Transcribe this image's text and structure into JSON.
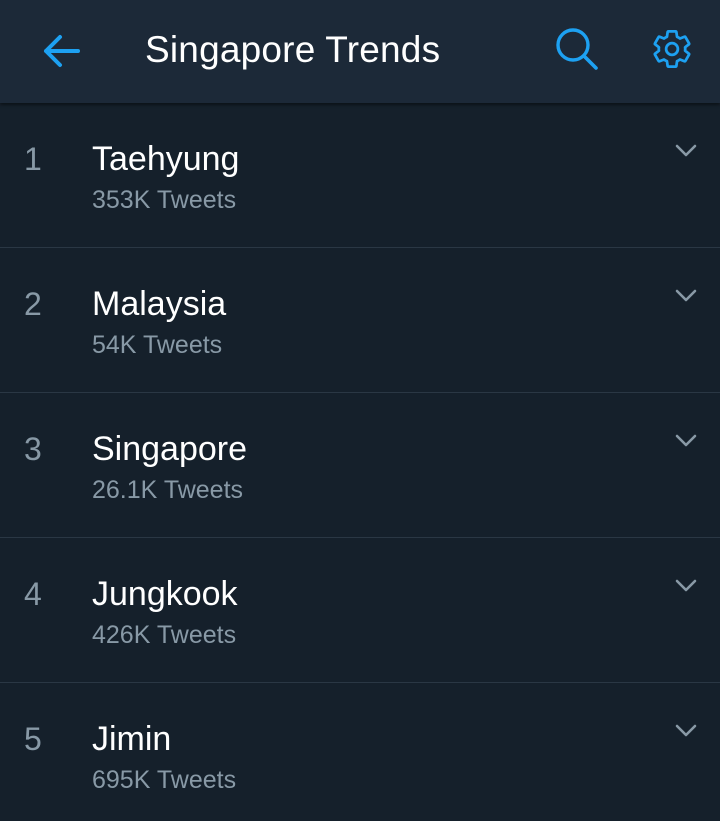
{
  "header": {
    "title": "Singapore Trends",
    "back_icon": "arrow-left-icon",
    "search_icon": "search-icon",
    "settings_icon": "gear-icon"
  },
  "colors": {
    "accent": "#1da1f2",
    "background": "#15202b",
    "header_background": "#1c2938",
    "secondary_text": "#8899a6",
    "divider": "#2a3744"
  },
  "trends": [
    {
      "rank": "1",
      "name": "Taehyung",
      "count": "353K Tweets"
    },
    {
      "rank": "2",
      "name": "Malaysia",
      "count": "54K Tweets"
    },
    {
      "rank": "3",
      "name": "Singapore",
      "count": "26.1K Tweets"
    },
    {
      "rank": "4",
      "name": "Jungkook",
      "count": "426K Tweets"
    },
    {
      "rank": "5",
      "name": "Jimin",
      "count": "695K Tweets"
    }
  ]
}
